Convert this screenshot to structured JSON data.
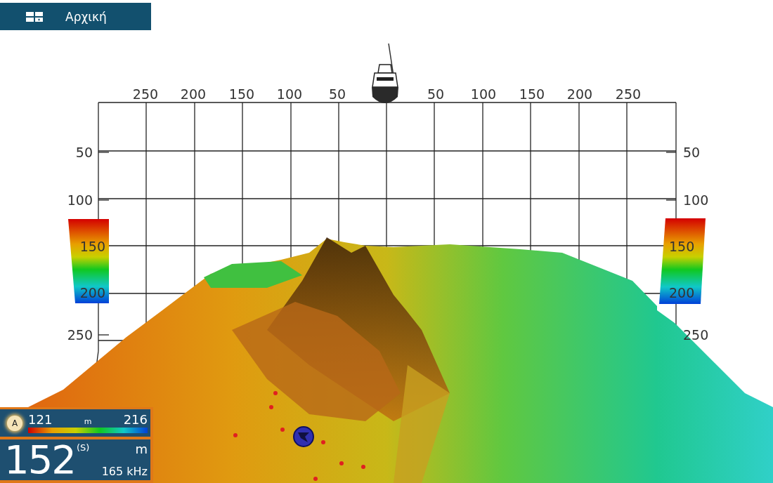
{
  "home_button": {
    "label": "Αρχική"
  },
  "grid": {
    "top_labels": [
      "250",
      "200",
      "150",
      "100",
      "50",
      "50",
      "100",
      "150",
      "200",
      "250"
    ],
    "left_labels": [
      "50",
      "100",
      "150",
      "200",
      "250"
    ],
    "right_labels": [
      "50",
      "100",
      "150",
      "200",
      "250"
    ]
  },
  "depth_panel": {
    "mode": "A",
    "min": "121",
    "unit": "m",
    "max": "216"
  },
  "readout": {
    "depth": "152",
    "suffix": "(S)",
    "unit": "m",
    "frequency": "165 kHz"
  }
}
